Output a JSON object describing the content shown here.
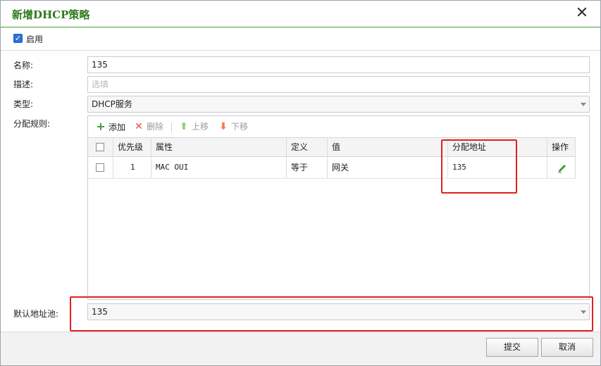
{
  "dialog": {
    "title": "新增DHCP策略",
    "close_symbol": "✕"
  },
  "enable": {
    "label": "启用",
    "checked": true
  },
  "form": {
    "name_label": "名称:",
    "name_value": "135",
    "desc_label": "描述:",
    "desc_placeholder": "选填",
    "type_label": "类型:",
    "type_value": "DHCP服务",
    "rules_label": "分配规则:",
    "pool_label": "默认地址池:",
    "pool_value": "135"
  },
  "toolbar": {
    "add": {
      "label": "添加",
      "icon": "plus-icon",
      "color": "#3c9a2e"
    },
    "delete": {
      "label": "删除",
      "icon": "x-icon",
      "color": "#e8523a"
    },
    "up": {
      "label": "上移",
      "icon": "arrow-up-icon",
      "color": "#8fcf6a"
    },
    "down": {
      "label": "下移",
      "icon": "arrow-down-icon",
      "color": "#f07a4a"
    }
  },
  "grid": {
    "headers": {
      "priority": "优先级",
      "attribute": "属性",
      "definition": "定义",
      "value": "值",
      "address": "分配地址",
      "action": "操作"
    },
    "rows": [
      {
        "priority": "1",
        "attribute": "MAC OUI",
        "definition": "等于",
        "value": "网关",
        "address": "135",
        "action_icon": "pencil-icon"
      }
    ]
  },
  "footer": {
    "submit_label": "提交",
    "cancel_label": "取消"
  },
  "colors": {
    "title_green": "#2f7a1f",
    "highlight_red": "#e02020",
    "checkbox_blue": "#2f72d6"
  }
}
